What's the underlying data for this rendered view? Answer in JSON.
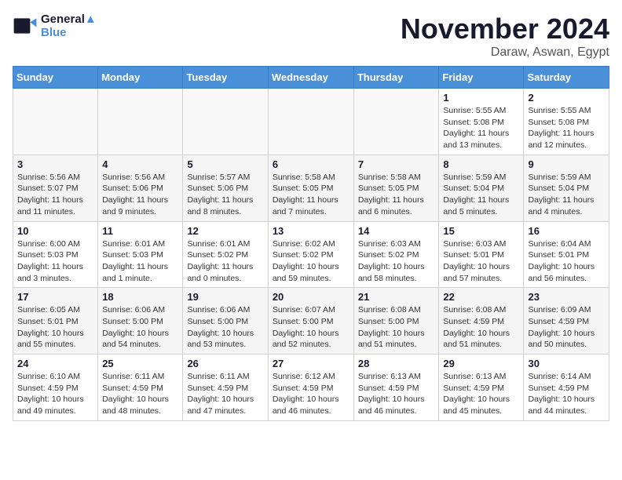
{
  "logo": {
    "line1": "General",
    "line2": "Blue"
  },
  "title": "November 2024",
  "location": "Daraw, Aswan, Egypt",
  "days_of_week": [
    "Sunday",
    "Monday",
    "Tuesday",
    "Wednesday",
    "Thursday",
    "Friday",
    "Saturday"
  ],
  "weeks": [
    [
      {
        "day": "",
        "info": ""
      },
      {
        "day": "",
        "info": ""
      },
      {
        "day": "",
        "info": ""
      },
      {
        "day": "",
        "info": ""
      },
      {
        "day": "",
        "info": ""
      },
      {
        "day": "1",
        "info": "Sunrise: 5:55 AM\nSunset: 5:08 PM\nDaylight: 11 hours and 13 minutes."
      },
      {
        "day": "2",
        "info": "Sunrise: 5:55 AM\nSunset: 5:08 PM\nDaylight: 11 hours and 12 minutes."
      }
    ],
    [
      {
        "day": "3",
        "info": "Sunrise: 5:56 AM\nSunset: 5:07 PM\nDaylight: 11 hours and 11 minutes."
      },
      {
        "day": "4",
        "info": "Sunrise: 5:56 AM\nSunset: 5:06 PM\nDaylight: 11 hours and 9 minutes."
      },
      {
        "day": "5",
        "info": "Sunrise: 5:57 AM\nSunset: 5:06 PM\nDaylight: 11 hours and 8 minutes."
      },
      {
        "day": "6",
        "info": "Sunrise: 5:58 AM\nSunset: 5:05 PM\nDaylight: 11 hours and 7 minutes."
      },
      {
        "day": "7",
        "info": "Sunrise: 5:58 AM\nSunset: 5:05 PM\nDaylight: 11 hours and 6 minutes."
      },
      {
        "day": "8",
        "info": "Sunrise: 5:59 AM\nSunset: 5:04 PM\nDaylight: 11 hours and 5 minutes."
      },
      {
        "day": "9",
        "info": "Sunrise: 5:59 AM\nSunset: 5:04 PM\nDaylight: 11 hours and 4 minutes."
      }
    ],
    [
      {
        "day": "10",
        "info": "Sunrise: 6:00 AM\nSunset: 5:03 PM\nDaylight: 11 hours and 3 minutes."
      },
      {
        "day": "11",
        "info": "Sunrise: 6:01 AM\nSunset: 5:03 PM\nDaylight: 11 hours and 1 minute."
      },
      {
        "day": "12",
        "info": "Sunrise: 6:01 AM\nSunset: 5:02 PM\nDaylight: 11 hours and 0 minutes."
      },
      {
        "day": "13",
        "info": "Sunrise: 6:02 AM\nSunset: 5:02 PM\nDaylight: 10 hours and 59 minutes."
      },
      {
        "day": "14",
        "info": "Sunrise: 6:03 AM\nSunset: 5:02 PM\nDaylight: 10 hours and 58 minutes."
      },
      {
        "day": "15",
        "info": "Sunrise: 6:03 AM\nSunset: 5:01 PM\nDaylight: 10 hours and 57 minutes."
      },
      {
        "day": "16",
        "info": "Sunrise: 6:04 AM\nSunset: 5:01 PM\nDaylight: 10 hours and 56 minutes."
      }
    ],
    [
      {
        "day": "17",
        "info": "Sunrise: 6:05 AM\nSunset: 5:01 PM\nDaylight: 10 hours and 55 minutes."
      },
      {
        "day": "18",
        "info": "Sunrise: 6:06 AM\nSunset: 5:00 PM\nDaylight: 10 hours and 54 minutes."
      },
      {
        "day": "19",
        "info": "Sunrise: 6:06 AM\nSunset: 5:00 PM\nDaylight: 10 hours and 53 minutes."
      },
      {
        "day": "20",
        "info": "Sunrise: 6:07 AM\nSunset: 5:00 PM\nDaylight: 10 hours and 52 minutes."
      },
      {
        "day": "21",
        "info": "Sunrise: 6:08 AM\nSunset: 5:00 PM\nDaylight: 10 hours and 51 minutes."
      },
      {
        "day": "22",
        "info": "Sunrise: 6:08 AM\nSunset: 4:59 PM\nDaylight: 10 hours and 51 minutes."
      },
      {
        "day": "23",
        "info": "Sunrise: 6:09 AM\nSunset: 4:59 PM\nDaylight: 10 hours and 50 minutes."
      }
    ],
    [
      {
        "day": "24",
        "info": "Sunrise: 6:10 AM\nSunset: 4:59 PM\nDaylight: 10 hours and 49 minutes."
      },
      {
        "day": "25",
        "info": "Sunrise: 6:11 AM\nSunset: 4:59 PM\nDaylight: 10 hours and 48 minutes."
      },
      {
        "day": "26",
        "info": "Sunrise: 6:11 AM\nSunset: 4:59 PM\nDaylight: 10 hours and 47 minutes."
      },
      {
        "day": "27",
        "info": "Sunrise: 6:12 AM\nSunset: 4:59 PM\nDaylight: 10 hours and 46 minutes."
      },
      {
        "day": "28",
        "info": "Sunrise: 6:13 AM\nSunset: 4:59 PM\nDaylight: 10 hours and 46 minutes."
      },
      {
        "day": "29",
        "info": "Sunrise: 6:13 AM\nSunset: 4:59 PM\nDaylight: 10 hours and 45 minutes."
      },
      {
        "day": "30",
        "info": "Sunrise: 6:14 AM\nSunset: 4:59 PM\nDaylight: 10 hours and 44 minutes."
      }
    ]
  ]
}
